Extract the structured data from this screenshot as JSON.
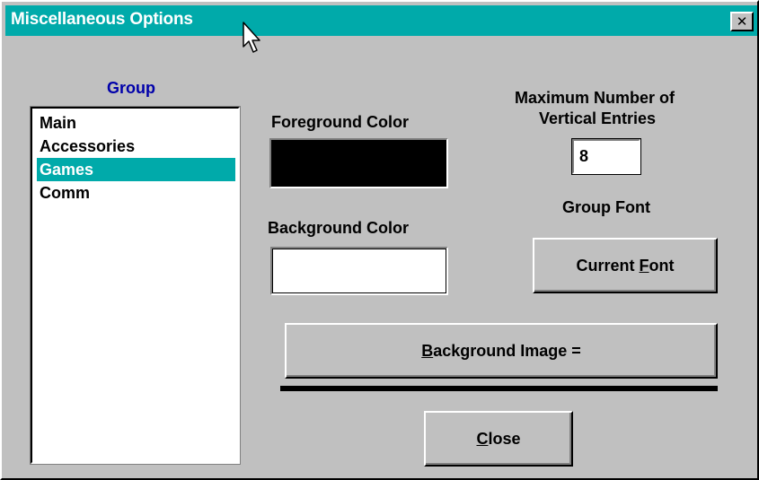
{
  "window": {
    "title": "Miscellaneous Options",
    "close_glyph": "✕"
  },
  "group": {
    "label": "Group",
    "items": [
      {
        "label": "Main",
        "selected": false
      },
      {
        "label": "Accessories",
        "selected": false
      },
      {
        "label": "Games",
        "selected": true
      },
      {
        "label": "Comm",
        "selected": false
      }
    ]
  },
  "colors": {
    "foreground_label": "Foreground Color",
    "foreground_value": "#000000",
    "background_label": "Background Color",
    "background_value": "#ffffff"
  },
  "vertical_entries": {
    "label_line1": "Maximum Number of",
    "label_line2": "Vertical Entries",
    "value": "8"
  },
  "group_font": {
    "label": "Group Font",
    "button_pre": "Current ",
    "button_accel": "F",
    "button_post": "ont"
  },
  "background_image": {
    "button_accel": "B",
    "button_post": "ackground Image ="
  },
  "close": {
    "button_accel": "C",
    "button_post": "lose"
  },
  "theme": {
    "titlebar": "#00aaaa",
    "face": "#c0c0c0",
    "group_label_color": "#0000aa"
  },
  "icons": {
    "cursor": "arrow-cursor-icon"
  }
}
